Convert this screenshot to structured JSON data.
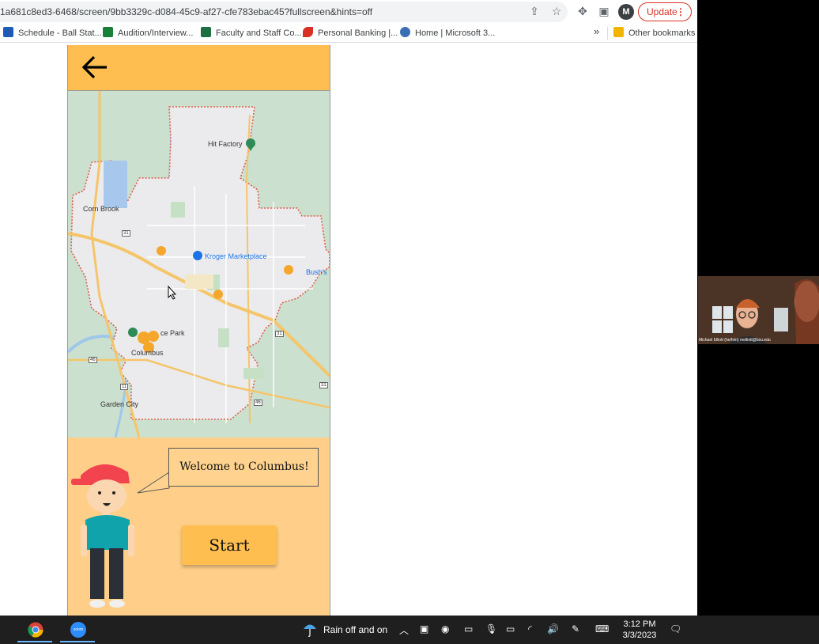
{
  "browser": {
    "url": "1a681c8ed3-6468/screen/9bb3329c-d084-45c9-af27-cfe783ebac45?fullscreen&hints=off",
    "avatar_letter": "M",
    "update_label": "Update",
    "bookmarks": [
      {
        "label": "Schedule - Ball Stat...",
        "icon": "v-logo-icon",
        "color": "#1e5bb8"
      },
      {
        "label": "Audition/Interview...",
        "icon": "green-cross-icon",
        "color": "#188038"
      },
      {
        "label": "Faculty and Staff Co...",
        "icon": "excel-icon",
        "color": "#1d6f42"
      },
      {
        "label": "Personal Banking |...",
        "icon": "bank-swoosh-icon",
        "color": "#d93025"
      },
      {
        "label": "Home | Microsoft 3...",
        "icon": "gear-badge-icon",
        "color": "#3b6fb5"
      }
    ],
    "overflow_label": "»",
    "other_bookmarks": "Other bookmarks"
  },
  "app": {
    "header_color": "#ffbe4f",
    "map": {
      "labels": {
        "hit_factory": "Hit Factory",
        "corn_brook": "Corn Brook",
        "kroger": "Kroger Marketplace",
        "bushs": "Bush's",
        "ce_park": "ce Park",
        "columbus": "Columbus",
        "garden_city": "Garden City"
      },
      "shields": {
        "route_31_a": "31",
        "route_31_b": "31",
        "route_31_c": "31",
        "route_46_a": "46",
        "route_46_b": "46",
        "route_11": "11"
      }
    },
    "panel_color": "#ffcf89",
    "speech_bubble": "Welcome to Columbus!",
    "start_label": "Start"
  },
  "zoom": {
    "participant": "Michael Elliott (he/him) melliott@bsu.edu"
  },
  "taskbar": {
    "weather": "Rain off and on",
    "time": "3:12 PM",
    "date": "3/3/2023"
  }
}
